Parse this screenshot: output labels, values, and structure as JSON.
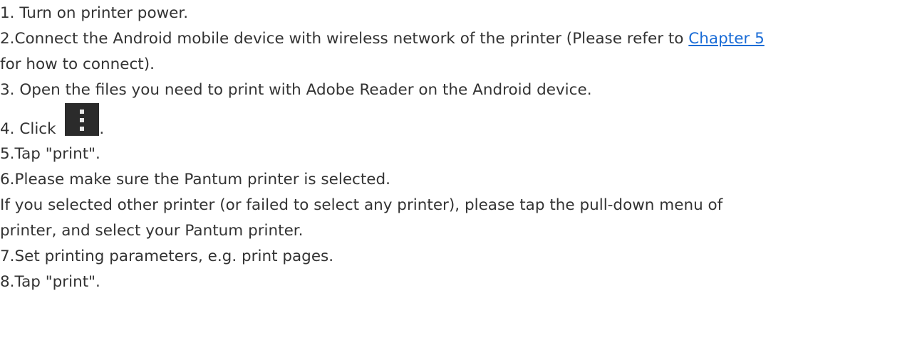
{
  "steps": {
    "step1": "1. Turn on printer power.",
    "step2_before": "2.Connect the Android mobile device with wireless network of the printer (Please refer to ",
    "step2_link": "Chapter 5",
    "step2_after": "for how to connect).",
    "step3": "3. Open the files you need to print with Adobe Reader on the Android device.",
    "step4_prefix": "4. Click ",
    "step4_suffix": ".",
    "step4_icon": "more-vertical-icon",
    "step5": "5.Tap \"print\".",
    "step6": "6.Please make sure the Pantum printer is selected.",
    "step6_note_line1": "If you selected other printer (or failed to select any printer), please tap the pull-down menu of",
    "step6_note_line2": "printer, and select your Pantum printer.",
    "step7": "7.Set printing parameters, e.g. print pages.",
    "step8": "8.Tap \"print\"."
  },
  "colors": {
    "text": "#333333",
    "link": "#1a6cd6",
    "icon_background": "#2b2b2b",
    "icon_dots": "#e8e8e8"
  }
}
